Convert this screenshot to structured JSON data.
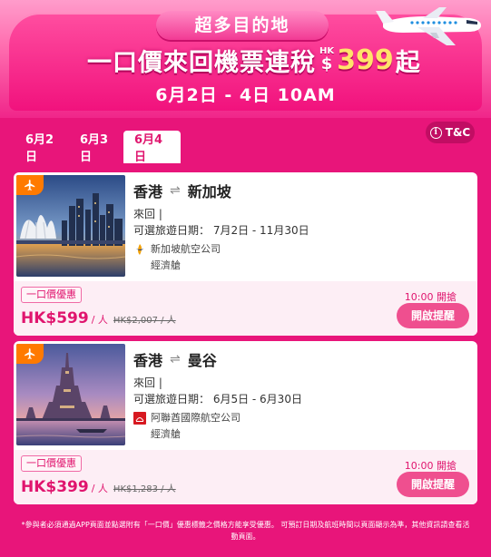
{
  "banner": {
    "subtitle": "超多目的地",
    "headline": "一口價來回機票連稅",
    "currency_small": "HK",
    "currency_symbol": "$",
    "headline_price": "399",
    "headline_suffix": "起",
    "date_range": "6月2日 - 4日 10AM"
  },
  "tnc_label": "T&C",
  "tabs": [
    {
      "label": "6月2日",
      "active": false
    },
    {
      "label": "6月3日",
      "active": false
    },
    {
      "label": "6月4日",
      "active": true
    }
  ],
  "deals": [
    {
      "origin": "香港",
      "arrows": "⇌",
      "destination": "新加坡",
      "trip_type": "來回 |",
      "travel_dates": "可選旅遊日期： 7月2日  - 11月30日",
      "airline": "新加坡航空公司",
      "cabin": "經濟艙",
      "deal_tag": "一口價優惠",
      "price": "HK$599",
      "per_person": "/ 人",
      "original_price": "HK$2,007 / 人",
      "open_time": "10:00 開搶",
      "remind_label": "開啟提醒"
    },
    {
      "origin": "香港",
      "arrows": "⇌",
      "destination": "曼谷",
      "trip_type": "來回 |",
      "travel_dates": "可選旅遊日期： 6月5日  - 6月30日",
      "airline": "阿聯酋國際航空公司",
      "cabin": "經濟艙",
      "deal_tag": "一口價優惠",
      "price": "HK$399",
      "per_person": "/ 人",
      "original_price": "HK$1,283 / 人",
      "open_time": "10:00 開搶",
      "remind_label": "開啟提醒"
    }
  ],
  "footer_note": "*參與者必須通過APP頁面並點選附有「一口價」優惠標籤之價格方能享受優惠。 可預訂日期及航班時間以頁面顯示為準，其他資訊請查看活動頁面。",
  "colors": {
    "accent": "#e0156e",
    "background": "#e8157a",
    "button": "#ef4f8f",
    "badge": "#ff7a00"
  },
  "icons": [
    "info-icon",
    "plane-icon",
    "singapore-airlines-logo",
    "emirates-logo",
    "airplane-illustration"
  ]
}
